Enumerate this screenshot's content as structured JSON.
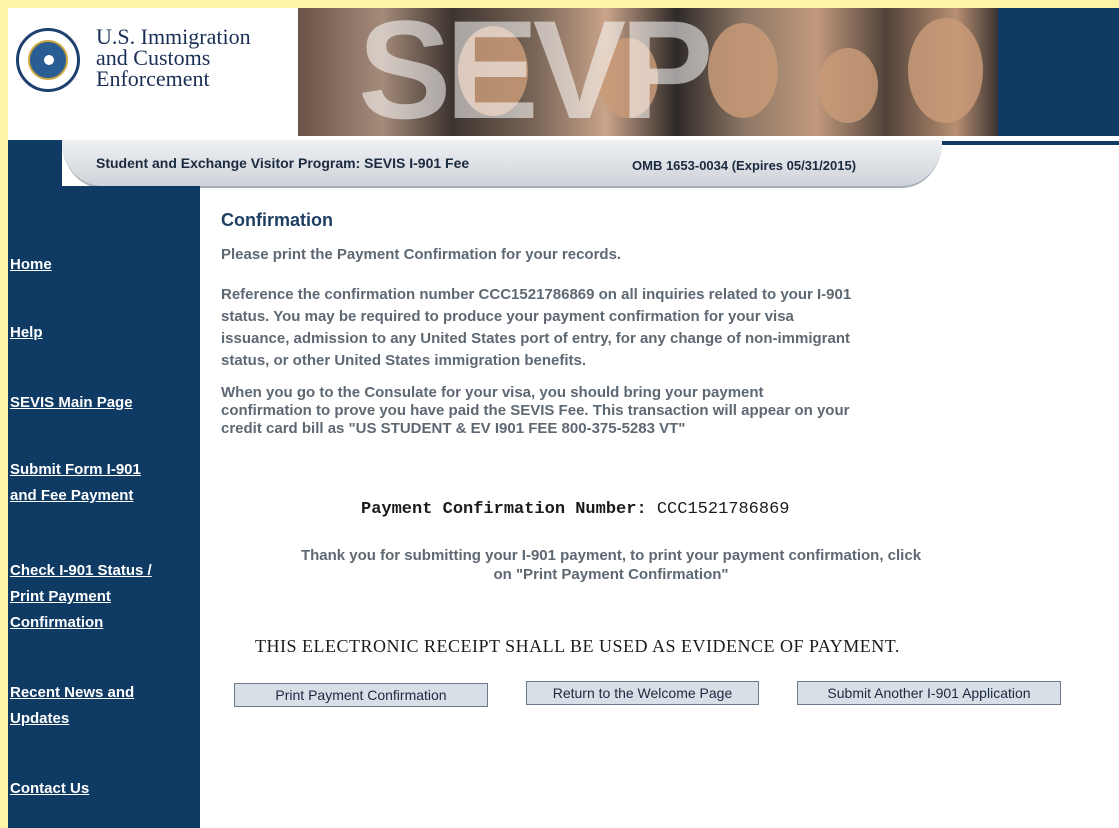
{
  "header": {
    "agency_line1": "U.S. Immigration",
    "agency_line2": "and Customs",
    "agency_line3": "Enforcement",
    "banner_text": "SEVP"
  },
  "program_bar": {
    "title": "Student and Exchange Visitor Program: SEVIS I-901 Fee",
    "omb": "OMB 1653-0034 (Expires 05/31/2015)"
  },
  "sidebar": {
    "items": [
      {
        "label_lines": [
          "Home"
        ]
      },
      {
        "label_lines": [
          "Help"
        ]
      },
      {
        "label_lines": [
          "SEVIS Main Page"
        ]
      },
      {
        "label_lines": [
          "Submit Form I-901",
          "and Fee Payment"
        ]
      },
      {
        "label_lines": [
          "Check I-901 Status /",
          "Print Payment",
          "Confirmation"
        ]
      },
      {
        "label_lines": [
          "Recent News and",
          "Updates"
        ]
      },
      {
        "label_lines": [
          "Contact Us"
        ]
      }
    ]
  },
  "main": {
    "heading": "Confirmation",
    "intro": "Please print the Payment Confirmation for your records.",
    "reference": [
      "Reference the confirmation number CCC1521786869 on all inquiries related to your I-901",
      "status. You may be required to produce your payment confirmation for your visa",
      "issuance, admission to any United States port of entry, for any change of non-immigrant",
      "status, or other United States immigration benefits."
    ],
    "consulate": [
      "When you go to the Consulate for your visa, you should bring your payment",
      "confirmation to prove you have paid the SEVIS Fee. This transaction will appear on your",
      "credit card bill as \"US STUDENT & EV I901 FEE 800-375-5283 VT\""
    ],
    "pcn_label": "Payment Confirmation Number:",
    "pcn_value": "CCC1521786869",
    "thanks_line1": "Thank you for submitting your I-901 payment, to print your payment confirmation, click",
    "thanks_line2": "on \"Print Payment Confirmation\"",
    "receipt_notice": "THIS ELECTRONIC RECEIPT SHALL BE USED AS EVIDENCE OF PAYMENT.",
    "buttons": {
      "print": "Print Payment Confirmation",
      "return": "Return to the Welcome Page",
      "another": "Submit Another I-901 Application"
    }
  },
  "colors": {
    "navy": "#0f3a63",
    "frame_yellow": "#fff4a6",
    "heading_blue": "#1e3e62",
    "body_gray": "#5e6873"
  }
}
